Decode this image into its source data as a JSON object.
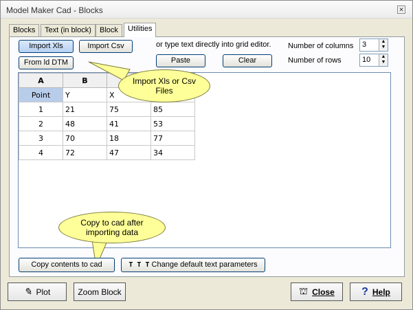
{
  "window": {
    "title": "Model Maker Cad - Blocks",
    "close_glyph": "✕"
  },
  "tabs": [
    {
      "label": "Blocks"
    },
    {
      "label": "Text (in block)"
    },
    {
      "label": "Block"
    },
    {
      "label": "Utilities"
    }
  ],
  "toolbar": {
    "import_xls": "Import Xls",
    "import_csv": "Import Csv",
    "from_ld_dtm": "From ld DTM",
    "hint": "or type text directly into grid editor.",
    "paste": "Paste",
    "clear": "Clear",
    "num_columns_label": "Number of columns",
    "num_columns_value": "3",
    "num_rows_label": "Number of rows",
    "num_rows_value": "10"
  },
  "grid": {
    "headers": [
      "A",
      "B",
      "",
      ""
    ],
    "rows": [
      [
        "Point",
        "Y",
        "X",
        ""
      ],
      [
        "1",
        "21",
        "75",
        "85"
      ],
      [
        "2",
        "48",
        "41",
        "53"
      ],
      [
        "3",
        "70",
        "18",
        "77"
      ],
      [
        "4",
        "72",
        "47",
        "34"
      ]
    ]
  },
  "callouts": {
    "import": "Import Xls or Csv Files",
    "copy": "Copy to cad after importing data"
  },
  "panel_buttons": {
    "copy_contents": "Copy contents to cad",
    "change_text": "Change default text parameters"
  },
  "footer": {
    "plot": "Plot",
    "zoom_block": "Zoom Block",
    "close": "Close",
    "help": "Help"
  },
  "colors": {
    "callout": "#ffff99",
    "selected_cell": "#b8cde9",
    "accent_border": "#003c74"
  }
}
